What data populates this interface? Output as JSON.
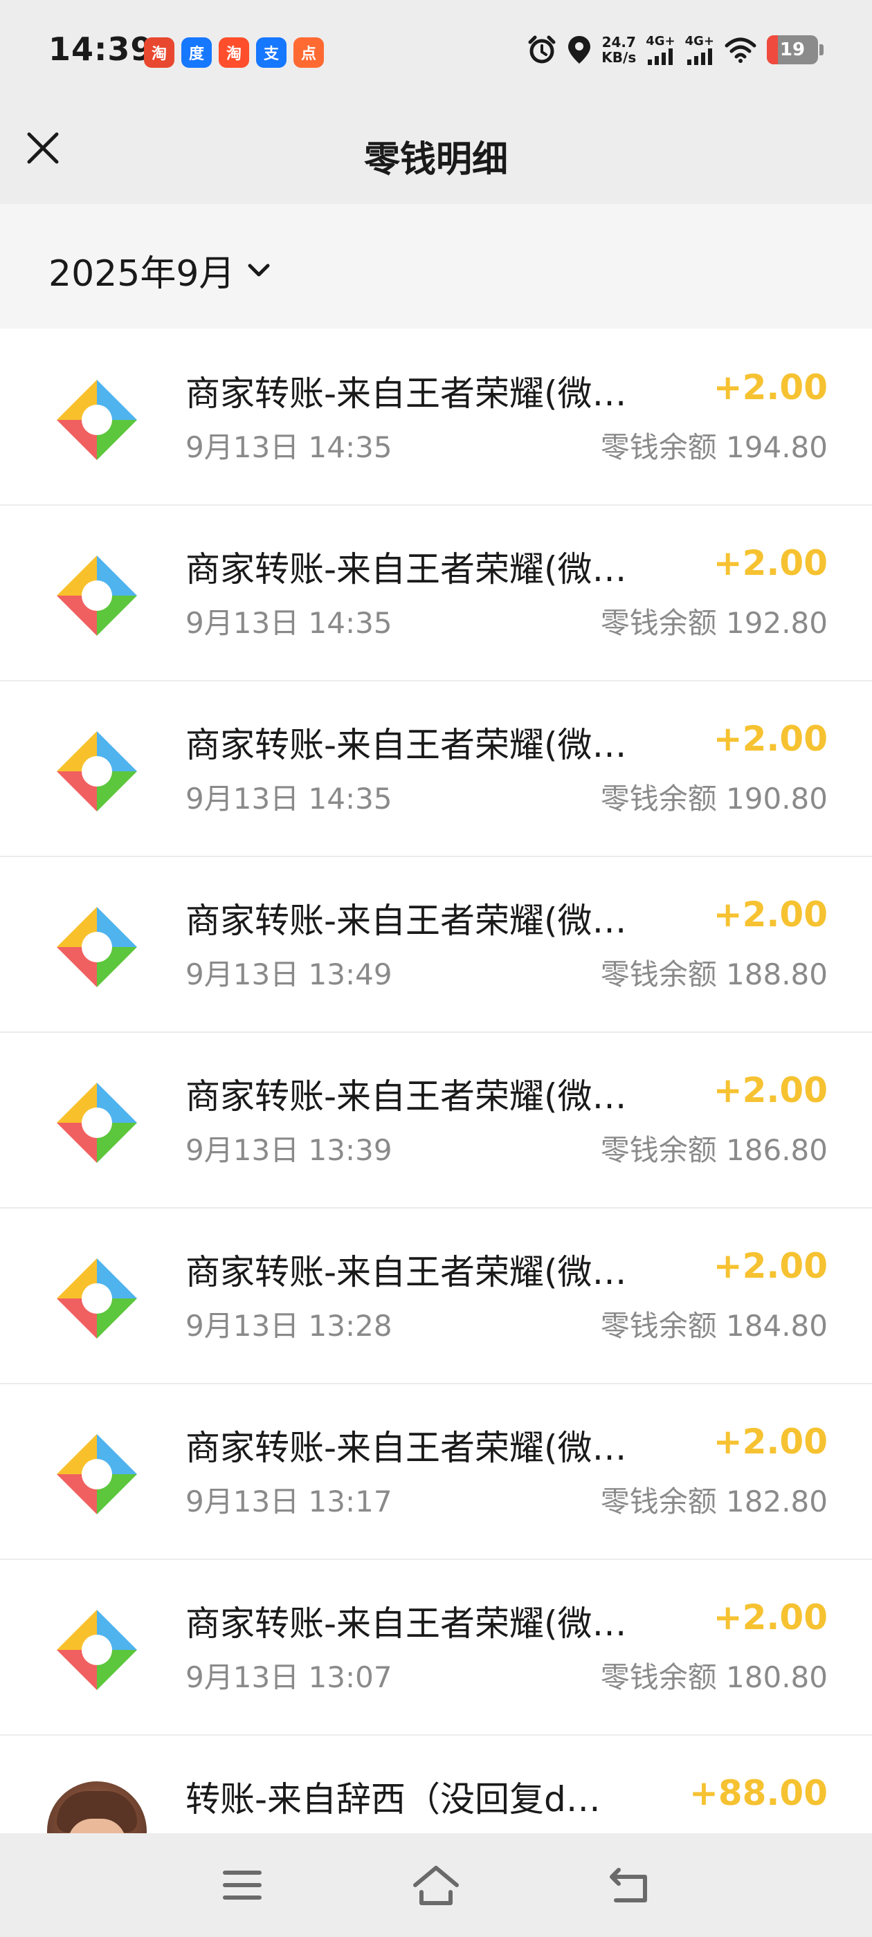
{
  "status_bar": {
    "time": "14:39",
    "net_speed_value": "24.7",
    "net_speed_unit": "KB/s",
    "sim1": "4G+",
    "sim2": "4G+",
    "battery": "19",
    "app_icons": [
      "taowaimai-icon",
      "baidu-icon",
      "taobao-icon",
      "alipay-icon",
      "dianping-icon"
    ]
  },
  "header": {
    "title": "零钱明细"
  },
  "filter": {
    "month": "2025年9月"
  },
  "transactions": [
    {
      "title": "商家转账-来自王者荣耀(微…",
      "date": "9月13日 14:35",
      "amount": "+2.00",
      "balance": "零钱余额 194.80"
    },
    {
      "title": "商家转账-来自王者荣耀(微…",
      "date": "9月13日 14:35",
      "amount": "+2.00",
      "balance": "零钱余额 192.80"
    },
    {
      "title": "商家转账-来自王者荣耀(微…",
      "date": "9月13日 14:35",
      "amount": "+2.00",
      "balance": "零钱余额 190.80"
    },
    {
      "title": "商家转账-来自王者荣耀(微…",
      "date": "9月13日 13:49",
      "amount": "+2.00",
      "balance": "零钱余额 188.80"
    },
    {
      "title": "商家转账-来自王者荣耀(微…",
      "date": "9月13日 13:39",
      "amount": "+2.00",
      "balance": "零钱余额 186.80"
    },
    {
      "title": "商家转账-来自王者荣耀(微…",
      "date": "9月13日 13:28",
      "amount": "+2.00",
      "balance": "零钱余额 184.80"
    },
    {
      "title": "商家转账-来自王者荣耀(微…",
      "date": "9月13日 13:17",
      "amount": "+2.00",
      "balance": "零钱余额 182.80"
    },
    {
      "title": "商家转账-来自王者荣耀(微…",
      "date": "9月13日 13:07",
      "amount": "+2.00",
      "balance": "零钱余额 180.80"
    },
    {
      "title": "转账-来自辞西（没回复d…",
      "date": "",
      "amount": "+88.00",
      "balance": ""
    }
  ],
  "colors": {
    "amount": "#f6c231",
    "logo_yellow": "#f8c12c",
    "logo_blue": "#4fb3ee",
    "logo_red": "#f06060",
    "logo_green": "#5cc63c"
  },
  "nav": {
    "menu_icon": "menu-icon",
    "home_icon": "home-icon",
    "back_icon": "back-icon"
  }
}
